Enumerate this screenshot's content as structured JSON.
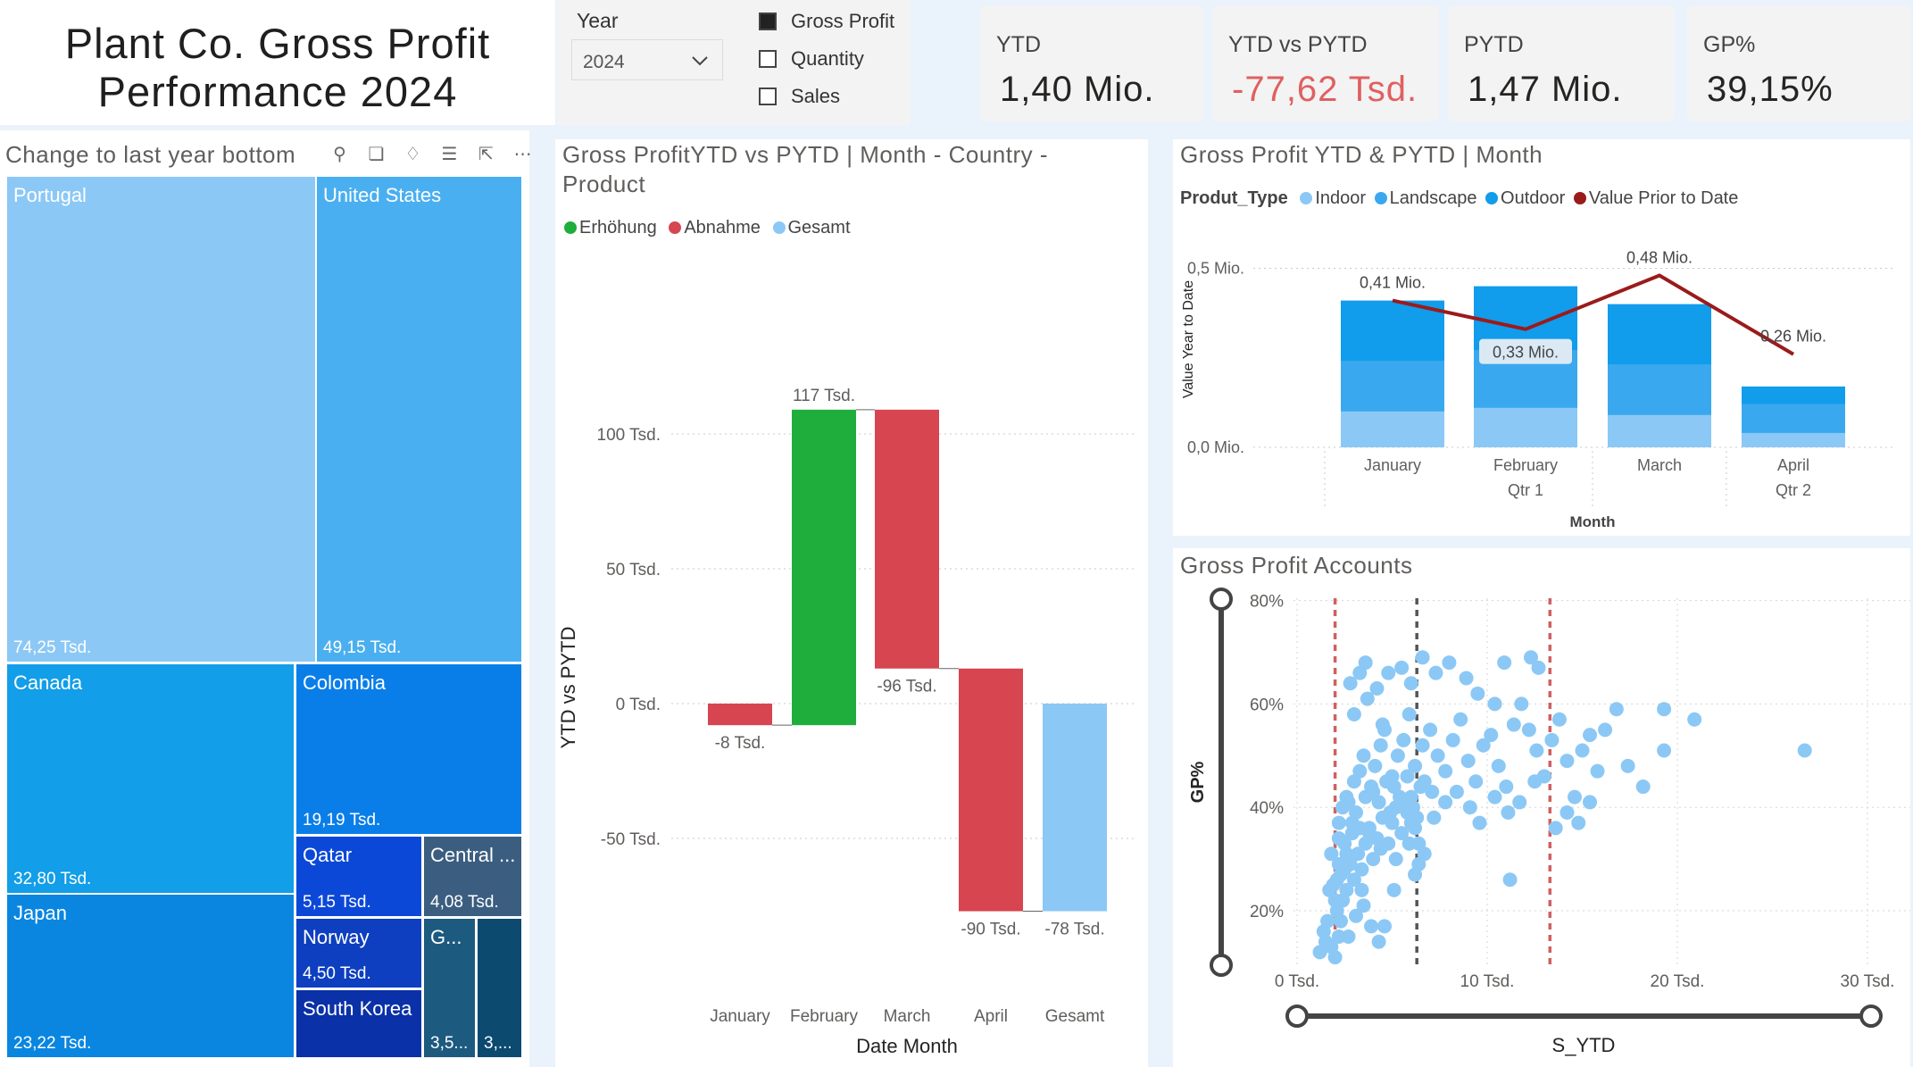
{
  "header": {
    "title_line1": "Plant Co. Gross Profit",
    "title_line2": "Performance 2024"
  },
  "slicer": {
    "year_label": "Year",
    "year_value": "2024",
    "options": [
      {
        "label": "Gross Profit",
        "checked": true
      },
      {
        "label": "Quantity",
        "checked": false
      },
      {
        "label": "Sales",
        "checked": false
      }
    ]
  },
  "kpis": [
    {
      "label": "YTD",
      "value": "1,40 Mio.",
      "color": "#252423"
    },
    {
      "label": "YTD vs PYTD",
      "value": "-77,62 Tsd.",
      "color": "#e06060"
    },
    {
      "label": "PYTD",
      "value": "1,47 Mio.",
      "color": "#252423"
    },
    {
      "label": "GP%",
      "value": "39,15%",
      "color": "#252423"
    }
  ],
  "treemap": {
    "title": "Change to last year bottom",
    "header_icons": [
      "pin-icon",
      "copy-icon",
      "bell-icon",
      "filter-icon",
      "focus-mode-icon",
      "more-options-icon"
    ],
    "tiles": [
      {
        "name": "Portugal",
        "value": "74,25 Tsd.",
        "color": "#8cc8f5"
      },
      {
        "name": "United States",
        "value": "49,15 Tsd.",
        "color": "#4aaff0"
      },
      {
        "name": "Canada",
        "value": "32,80 Tsd.",
        "color": "#129ee8"
      },
      {
        "name": "Colombia",
        "value": "19,19 Tsd.",
        "color": "#0a7ee8"
      },
      {
        "name": "Japan",
        "value": "23,22 Tsd.",
        "color": "#0a86e0"
      },
      {
        "name": "Qatar",
        "value": "5,15 Tsd.",
        "color": "#0c48d8"
      },
      {
        "name": "Central ...",
        "value": "4,08 Tsd.",
        "color": "#3b5e80"
      },
      {
        "name": "Norway",
        "value": "4,50 Tsd.",
        "color": "#0e3fc0"
      },
      {
        "name": "G...",
        "value": "3,5...",
        "color": "#1d5a80"
      },
      {
        "name": "",
        "value": "3,...",
        "color": "#0c4a70"
      },
      {
        "name": "South Korea",
        "value": "",
        "color": "#0b31a8"
      }
    ]
  },
  "waterfall": {
    "title_line1": "Gross ProfitYTD vs PYTD | Month - Country -",
    "title_line2": "Product",
    "legend": [
      {
        "label": "Erhöhung",
        "color": "#1fad3c"
      },
      {
        "label": "Abnahme",
        "color": "#d64550"
      },
      {
        "label": "Gesamt",
        "color": "#8cc8f5"
      }
    ],
    "ylabel": "YTD vs PYTD",
    "xlabel": "Date Month"
  },
  "combo": {
    "title": "Gross Profit YTD & PYTD | Month",
    "legend_title": "Produt_Type",
    "legend": [
      {
        "label": "Indoor",
        "color": "#8cc8f5"
      },
      {
        "label": "Landscape",
        "color": "#3aa8ee"
      },
      {
        "label": "Outdoor",
        "color": "#119cec"
      },
      {
        "label": "Value Prior to Date",
        "color": "#9a1b1b"
      }
    ],
    "ylabel": "Value Year to Date",
    "xlabel": "Month"
  },
  "scatter": {
    "title": "Gross Profit Accounts",
    "ylabel": "GP%",
    "xlabel": "S_YTD"
  },
  "chart_data": [
    {
      "type": "bar",
      "subtype": "waterfall",
      "title": "Gross ProfitYTD vs PYTD | Month - Country - Product",
      "xlabel": "Date Month",
      "ylabel": "YTD vs PYTD",
      "categories": [
        "January",
        "February",
        "March",
        "April",
        "Gesamt"
      ],
      "values": [
        -8,
        117,
        -96,
        -90,
        -78
      ],
      "value_labels": [
        "-8 Tsd.",
        "117 Tsd.",
        "-96 Tsd.",
        "-90 Tsd.",
        "-78 Tsd."
      ],
      "kinds": [
        "Abnahme",
        "Erhöhung",
        "Abnahme",
        "Abnahme",
        "Gesamt"
      ],
      "starts": [
        0,
        -8,
        109,
        13,
        0
      ],
      "ends": [
        -8,
        109,
        13,
        -77,
        -77
      ],
      "yticks": [
        100,
        50,
        0,
        -50
      ],
      "ytick_labels": [
        "100 Tsd.",
        "50 Tsd.",
        "0 Tsd.",
        "-50 Tsd."
      ],
      "ylim": [
        -77,
        117
      ],
      "legend": [
        "Erhöhung",
        "Abnahme",
        "Gesamt"
      ]
    },
    {
      "type": "bar",
      "subtype": "stacked-bar-with-line",
      "title": "Gross Profit YTD & PYTD | Month",
      "xlabel": "Month",
      "ylabel": "Value Year to Date",
      "categories": [
        "January",
        "February",
        "March",
        "April"
      ],
      "category_groups": [
        "",
        "Qtr 1",
        "",
        "Qtr 2"
      ],
      "series": [
        {
          "name": "Indoor",
          "values": [
            0.1,
            0.11,
            0.09,
            0.04
          ]
        },
        {
          "name": "Landscape",
          "values": [
            0.14,
            0.16,
            0.14,
            0.08
          ]
        },
        {
          "name": "Outdoor",
          "values": [
            0.17,
            0.18,
            0.17,
            0.05
          ]
        }
      ],
      "line": {
        "name": "Value Prior to Date",
        "values": [
          0.41,
          0.33,
          0.48,
          0.26
        ]
      },
      "labels": [
        "0,41 Mio.",
        "0,33 Mio.",
        "0,48 Mio.",
        "0,26 Mio."
      ],
      "yticks": [
        0.5,
        0.0
      ],
      "ytick_labels": [
        "0,5 Mio.",
        "0,0 Mio."
      ],
      "ylim": [
        0,
        0.5
      ]
    },
    {
      "type": "scatter",
      "title": "Gross Profit Accounts",
      "xlabel": "S_YTD",
      "ylabel": "GP%",
      "xticks": [
        0,
        10,
        20,
        30
      ],
      "xtick_labels": [
        "0 Tsd.",
        "10 Tsd.",
        "20 Tsd.",
        "30 Tsd."
      ],
      "yticks": [
        80,
        60,
        40,
        20
      ],
      "ytick_labels": [
        "80%",
        "60%",
        "40%",
        "20%"
      ],
      "xlim": [
        0,
        30
      ],
      "ylim": [
        10,
        80
      ],
      "reference_lines_x": [
        {
          "value": 2,
          "color": "#d06060"
        },
        {
          "value": 6.3,
          "color": "#555555"
        },
        {
          "value": 13.3,
          "color": "#d06060"
        }
      ],
      "points": [
        [
          1.2,
          12
        ],
        [
          1.5,
          14
        ],
        [
          1.8,
          13
        ],
        [
          2.0,
          11
        ],
        [
          2.2,
          15
        ],
        [
          1.6,
          18
        ],
        [
          2.1,
          20
        ],
        [
          2.4,
          22
        ],
        [
          1.9,
          25
        ],
        [
          2.3,
          27
        ],
        [
          2.6,
          24
        ],
        [
          2.8,
          29
        ],
        [
          3.0,
          26
        ],
        [
          3.2,
          31
        ],
        [
          2.5,
          33
        ],
        [
          2.9,
          35
        ],
        [
          3.4,
          28
        ],
        [
          3.6,
          33
        ],
        [
          3.8,
          36
        ],
        [
          4.0,
          30
        ],
        [
          4.2,
          34
        ],
        [
          4.5,
          38
        ],
        [
          4.8,
          33
        ],
        [
          5.0,
          37
        ],
        [
          5.2,
          40
        ],
        [
          5.5,
          35
        ],
        [
          5.8,
          39
        ],
        [
          6.0,
          42
        ],
        [
          6.2,
          36
        ],
        [
          6.5,
          44
        ],
        [
          2.2,
          37
        ],
        [
          2.4,
          40
        ],
        [
          2.6,
          42
        ],
        [
          3.0,
          45
        ],
        [
          3.3,
          47
        ],
        [
          3.5,
          50
        ],
        [
          3.9,
          44
        ],
        [
          4.1,
          48
        ],
        [
          4.4,
          52
        ],
        [
          4.6,
          55
        ],
        [
          5.0,
          46
        ],
        [
          5.3,
          50
        ],
        [
          5.6,
          53
        ],
        [
          5.9,
          58
        ],
        [
          6.2,
          48
        ],
        [
          6.6,
          52
        ],
        [
          7.0,
          55
        ],
        [
          7.4,
          50
        ],
        [
          7.8,
          47
        ],
        [
          8.2,
          53
        ],
        [
          8.6,
          57
        ],
        [
          9.0,
          49
        ],
        [
          9.4,
          45
        ],
        [
          9.8,
          52
        ],
        [
          10.2,
          54
        ],
        [
          10.6,
          48
        ],
        [
          11.0,
          44
        ],
        [
          11.4,
          56
        ],
        [
          11.8,
          60
        ],
        [
          12.2,
          55
        ],
        [
          12.6,
          51
        ],
        [
          13.0,
          46
        ],
        [
          13.4,
          53
        ],
        [
          13.8,
          57
        ],
        [
          14.2,
          49
        ],
        [
          14.6,
          42
        ],
        [
          15.0,
          51
        ],
        [
          15.4,
          54
        ],
        [
          15.8,
          47
        ],
        [
          16.2,
          55
        ],
        [
          16.8,
          59
        ],
        [
          17.4,
          48
        ],
        [
          18.2,
          44
        ],
        [
          19.3,
          51
        ],
        [
          19.3,
          59
        ],
        [
          20.9,
          57
        ],
        [
          26.7,
          51
        ],
        [
          2.8,
          64
        ],
        [
          3.3,
          66
        ],
        [
          3.6,
          68
        ],
        [
          4.2,
          63
        ],
        [
          4.8,
          66
        ],
        [
          5.5,
          67
        ],
        [
          6.0,
          64
        ],
        [
          6.6,
          69
        ],
        [
          7.3,
          66
        ],
        [
          8.0,
          68
        ],
        [
          8.9,
          65
        ],
        [
          9.5,
          62
        ],
        [
          10.4,
          60
        ],
        [
          10.9,
          68
        ],
        [
          12.3,
          69
        ],
        [
          12.7,
          67
        ],
        [
          3.0,
          58
        ],
        [
          3.7,
          61
        ],
        [
          4.5,
          56
        ],
        [
          2.0,
          22
        ],
        [
          2.3,
          18
        ],
        [
          2.7,
          15
        ],
        [
          3.1,
          19
        ],
        [
          3.5,
          21
        ],
        [
          3.9,
          17
        ],
        [
          4.3,
          14
        ],
        [
          1.4,
          16
        ],
        [
          1.7,
          24
        ],
        [
          2.2,
          29
        ],
        [
          2.6,
          31
        ],
        [
          5.2,
          30
        ],
        [
          5.9,
          33
        ],
        [
          6.4,
          29
        ],
        [
          7.2,
          38
        ],
        [
          7.8,
          41
        ],
        [
          8.4,
          43
        ],
        [
          9.1,
          40
        ],
        [
          9.6,
          37
        ],
        [
          10.4,
          42
        ],
        [
          11.1,
          39
        ],
        [
          11.7,
          41
        ],
        [
          12.5,
          45
        ],
        [
          13.6,
          36
        ],
        [
          14.2,
          39
        ],
        [
          14.8,
          37
        ],
        [
          15.4,
          41
        ],
        [
          5.1,
          44
        ],
        [
          5.4,
          42
        ],
        [
          5.8,
          46
        ],
        [
          6.1,
          40
        ],
        [
          6.3,
          38
        ],
        [
          6.7,
          45
        ],
        [
          7.1,
          43
        ],
        [
          3.1,
          39
        ],
        [
          3.6,
          42
        ],
        [
          4.0,
          43
        ],
        [
          4.3,
          41
        ],
        [
          4.7,
          45
        ],
        [
          4.9,
          39
        ],
        [
          5.6,
          41
        ],
        [
          6.0,
          37
        ],
        [
          2.7,
          41
        ],
        [
          3.3,
          36
        ],
        [
          3.8,
          35
        ],
        [
          4.4,
          32
        ],
        [
          2.9,
          37
        ],
        [
          11.2,
          26
        ],
        [
          4.6,
          17
        ],
        [
          5.1,
          24
        ],
        [
          6.2,
          27
        ],
        [
          6.4,
          33
        ],
        [
          6.7,
          31
        ],
        [
          3.4,
          24
        ],
        [
          2.1,
          26
        ],
        [
          2.5,
          28
        ],
        [
          1.8,
          31
        ],
        [
          2.2,
          34
        ]
      ]
    }
  ]
}
